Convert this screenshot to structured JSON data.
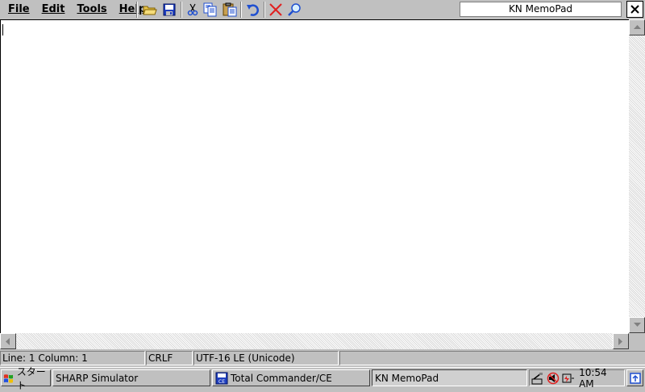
{
  "menubar": {
    "items": [
      "File",
      "Edit",
      "Tools",
      "Help"
    ]
  },
  "toolbar": {
    "buttons": [
      {
        "name": "open-icon"
      },
      {
        "name": "save-icon"
      },
      {
        "name": "cut-icon"
      },
      {
        "name": "copy-icon"
      },
      {
        "name": "paste-icon"
      },
      {
        "name": "undo-icon"
      },
      {
        "name": "delete-icon"
      },
      {
        "name": "find-icon"
      }
    ]
  },
  "window": {
    "title": "KN MemoPad",
    "close_label": "✕"
  },
  "editor": {
    "content": ""
  },
  "statusbar": {
    "position": "Line: 1 Column: 1",
    "line_ending": "CRLF",
    "encoding": "UTF-16 LE (Unicode)",
    "extra": ""
  },
  "taskbar": {
    "start_label": "スタート",
    "tasks": [
      {
        "label": "SHARP Simulator",
        "active": false
      },
      {
        "label": "Total Commander/CE",
        "active": false
      },
      {
        "label": "KN MemoPad",
        "active": true
      }
    ],
    "clock": "10:54 AM"
  },
  "colors": {
    "face": "#c0c0c0",
    "shadow": "#808080",
    "highlight": "#ffffff",
    "accent_blue": "#1f4fd0",
    "delete_red": "#e02020"
  }
}
